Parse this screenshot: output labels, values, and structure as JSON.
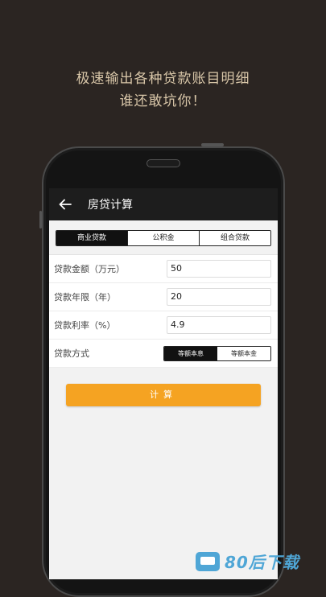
{
  "promo": {
    "line1": "极速输出各种贷款账目明细",
    "line2": "谁还敢坑你！"
  },
  "appbar": {
    "title": "房贷计算"
  },
  "tabs": [
    {
      "label": "商业贷款",
      "active": true
    },
    {
      "label": "公积金",
      "active": false
    },
    {
      "label": "组合贷款",
      "active": false
    }
  ],
  "form": {
    "amount": {
      "label": "贷款金额（万元）",
      "value": "50"
    },
    "years": {
      "label": "贷款年限（年）",
      "value": "20"
    },
    "rate": {
      "label": "贷款利率（%）",
      "value": "4.9"
    },
    "method": {
      "label": "贷款方式",
      "options": [
        {
          "label": "等额本息",
          "active": true
        },
        {
          "label": "等额本金",
          "active": false
        }
      ]
    }
  },
  "calculate_label": "计算",
  "watermark": {
    "text": "80后下载"
  },
  "colors": {
    "accent": "#f5a322",
    "appbar": "#1d1d1d",
    "background": "#2b2522",
    "promo_text": "#d8c6a8"
  }
}
